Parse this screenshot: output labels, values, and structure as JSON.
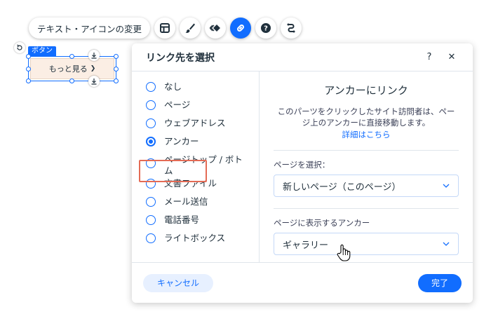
{
  "toolbar": {
    "text_icon_label": "テキスト・アイコンの変更",
    "icons": [
      "layout-icon",
      "brush-icon",
      "animation-icon",
      "link-icon",
      "help-icon",
      "connect-icon"
    ],
    "active_icon": "link-icon"
  },
  "canvas": {
    "element_tag": "ボタン",
    "button_label": "もっと見る",
    "button_arrow": "❯"
  },
  "panel": {
    "title": "リンク先を選択",
    "help_label": "?",
    "close_label": "✕",
    "options": [
      {
        "label": "なし",
        "checked": false
      },
      {
        "label": "ページ",
        "checked": false
      },
      {
        "label": "ウェブアドレス",
        "checked": false
      },
      {
        "label": "アンカー",
        "checked": true
      },
      {
        "label": "ページトップ / ボトム",
        "checked": false
      },
      {
        "label": "文書ファイル",
        "checked": false
      },
      {
        "label": "メール送信",
        "checked": false
      },
      {
        "label": "電話番号",
        "checked": false
      },
      {
        "label": "ライトボックス",
        "checked": false
      }
    ],
    "right": {
      "title": "アンカーにリンク",
      "description": "このパーツをクリックしたサイト訪問者は、ページ上のアンカーに直接移動します。",
      "link": "詳細はこちら",
      "page_label": "ページを選択：",
      "page_value": "新しいページ（このページ）",
      "anchor_label": "ページに表示するアンカー",
      "anchor_value": "ギャラリー"
    },
    "footer": {
      "cancel": "キャンセル",
      "done": "完了"
    }
  },
  "colors": {
    "accent": "#116dff",
    "highlight": "#e46b55",
    "button_bg": "#fbeee4"
  }
}
